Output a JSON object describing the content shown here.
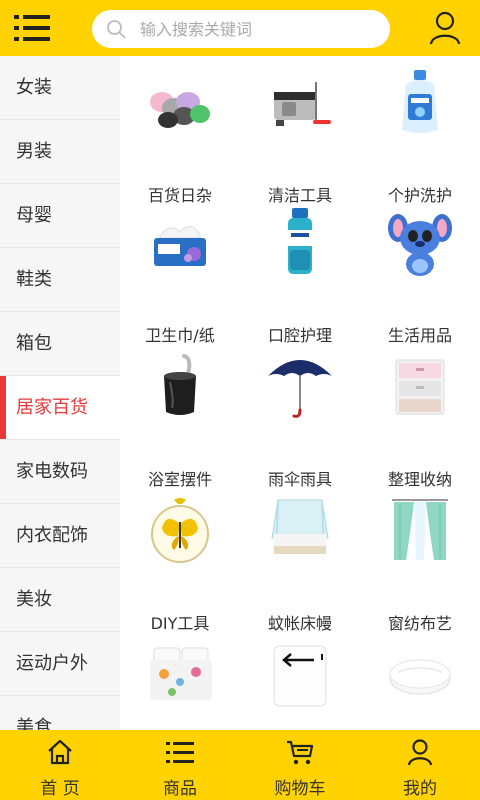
{
  "header": {
    "menu_icon": "list-menu-icon",
    "search_placeholder": "输入搜索关键词",
    "search_value": "",
    "user_icon": "user-icon",
    "accent_color": "#ffd200"
  },
  "sidebar": {
    "active_color": "#e83a3a",
    "items": [
      {
        "label": "女装"
      },
      {
        "label": "男装"
      },
      {
        "label": "母婴"
      },
      {
        "label": "鞋类"
      },
      {
        "label": "箱包"
      },
      {
        "label": "居家百货",
        "active": true
      },
      {
        "label": "家电数码"
      },
      {
        "label": "内衣配饰"
      },
      {
        "label": "美妆"
      },
      {
        "label": "运动户外"
      },
      {
        "label": "美食"
      }
    ]
  },
  "categories": [
    {
      "label": "百货日杂",
      "icon": "trash-bags-image"
    },
    {
      "label": "清洁工具",
      "icon": "mop-bucket-image"
    },
    {
      "label": "个护洗护",
      "icon": "detergent-bottle-image"
    },
    {
      "label": "卫生巾/纸",
      "icon": "tissue-box-image"
    },
    {
      "label": "口腔护理",
      "icon": "mouthwash-bottle-image"
    },
    {
      "label": "生活用品",
      "icon": "plush-toy-image"
    },
    {
      "label": "浴室摆件",
      "icon": "toilet-brush-holder-image"
    },
    {
      "label": "雨伞雨具",
      "icon": "umbrella-image"
    },
    {
      "label": "整理收纳",
      "icon": "storage-drawers-image"
    },
    {
      "label": "DIY工具",
      "icon": "butterfly-embroidery-hoop-image"
    },
    {
      "label": "蚊帐床幔",
      "icon": "mosquito-net-bed-image"
    },
    {
      "label": "窗纺布艺",
      "icon": "curtain-image"
    },
    {
      "label": "",
      "icon": "bedding-set-image"
    },
    {
      "label": "",
      "icon": "pillow-image"
    },
    {
      "label": "",
      "icon": "round-cushion-image"
    }
  ],
  "tabbar": {
    "tabs": [
      {
        "label": "首 页",
        "icon": "home-icon"
      },
      {
        "label": "商品",
        "icon": "list-icon"
      },
      {
        "label": "购物车",
        "icon": "cart-icon"
      },
      {
        "label": "我的",
        "icon": "user-icon"
      }
    ]
  }
}
